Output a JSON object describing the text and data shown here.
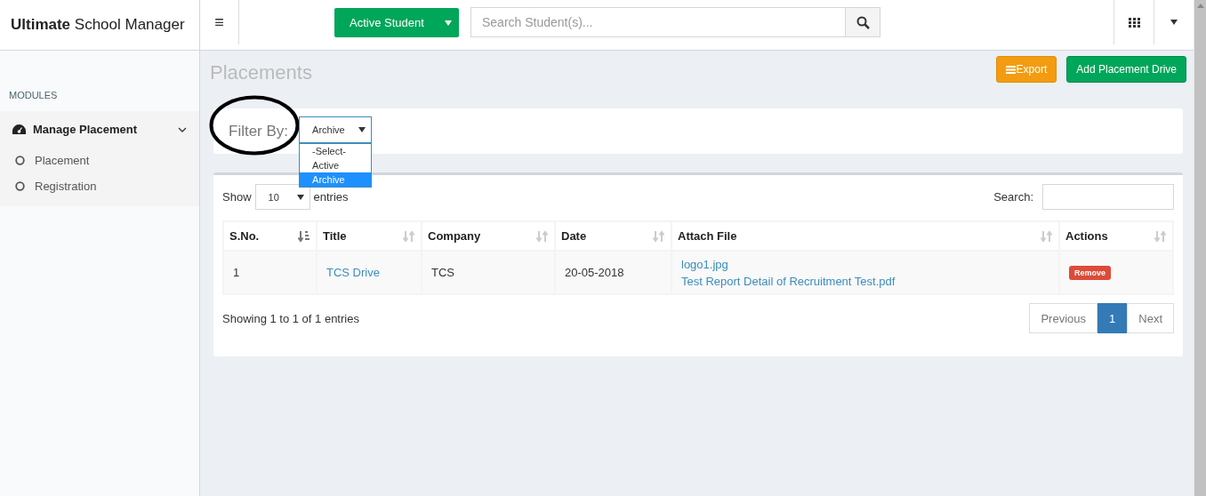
{
  "header": {
    "logo": "**Ultimate** School Manager",
    "menu_icon": "≡",
    "student_filter": "Active Student",
    "search": {
      "placeholder": "Search Student(s)..."
    }
  },
  "sidebar": {
    "section": "MODULES",
    "items": [
      {
        "label": "Manage Placement",
        "expanded": true,
        "children": [
          {
            "label": "Placement"
          },
          {
            "label": "Registration"
          }
        ]
      }
    ]
  },
  "page": {
    "title": "Placements",
    "buttons": [
      {
        "label": "Export",
        "kind": "export"
      },
      {
        "label": "Add Placement Drive",
        "kind": "add"
      }
    ]
  },
  "filter": {
    "label": "Filter By:",
    "value": "Archive",
    "options": [
      {
        "label": "-Select-",
        "selected": false
      },
      {
        "label": "Active",
        "selected": false
      },
      {
        "label": "Archive",
        "selected": true
      }
    ]
  },
  "table": {
    "show_label": "Show",
    "page_size": "10",
    "entries_label": "entries",
    "search_label": "Search:",
    "columns": [
      {
        "label": "S.No.",
        "sorted": true
      },
      {
        "label": "Title",
        "sorted": false
      },
      {
        "label": "Company",
        "sorted": false
      },
      {
        "label": "Date",
        "sorted": false
      },
      {
        "label": "Attach File",
        "sorted": false
      },
      {
        "label": "Actions",
        "sorted": false
      }
    ],
    "rows": [
      {
        "sno": "1",
        "title": "TCS Drive",
        "company": "TCS",
        "date": "20-05-2018",
        "files": [
          "logo1.jpg",
          "Test Report Detail of Recruitment Test.pdf"
        ],
        "action": "Remove"
      }
    ],
    "info": "Showing 1 to 1 of 1 entries",
    "pagination": {
      "previous": "Previous",
      "pages": [
        {
          "label": "1",
          "selected": true
        }
      ],
      "next": "Next"
    }
  }
}
